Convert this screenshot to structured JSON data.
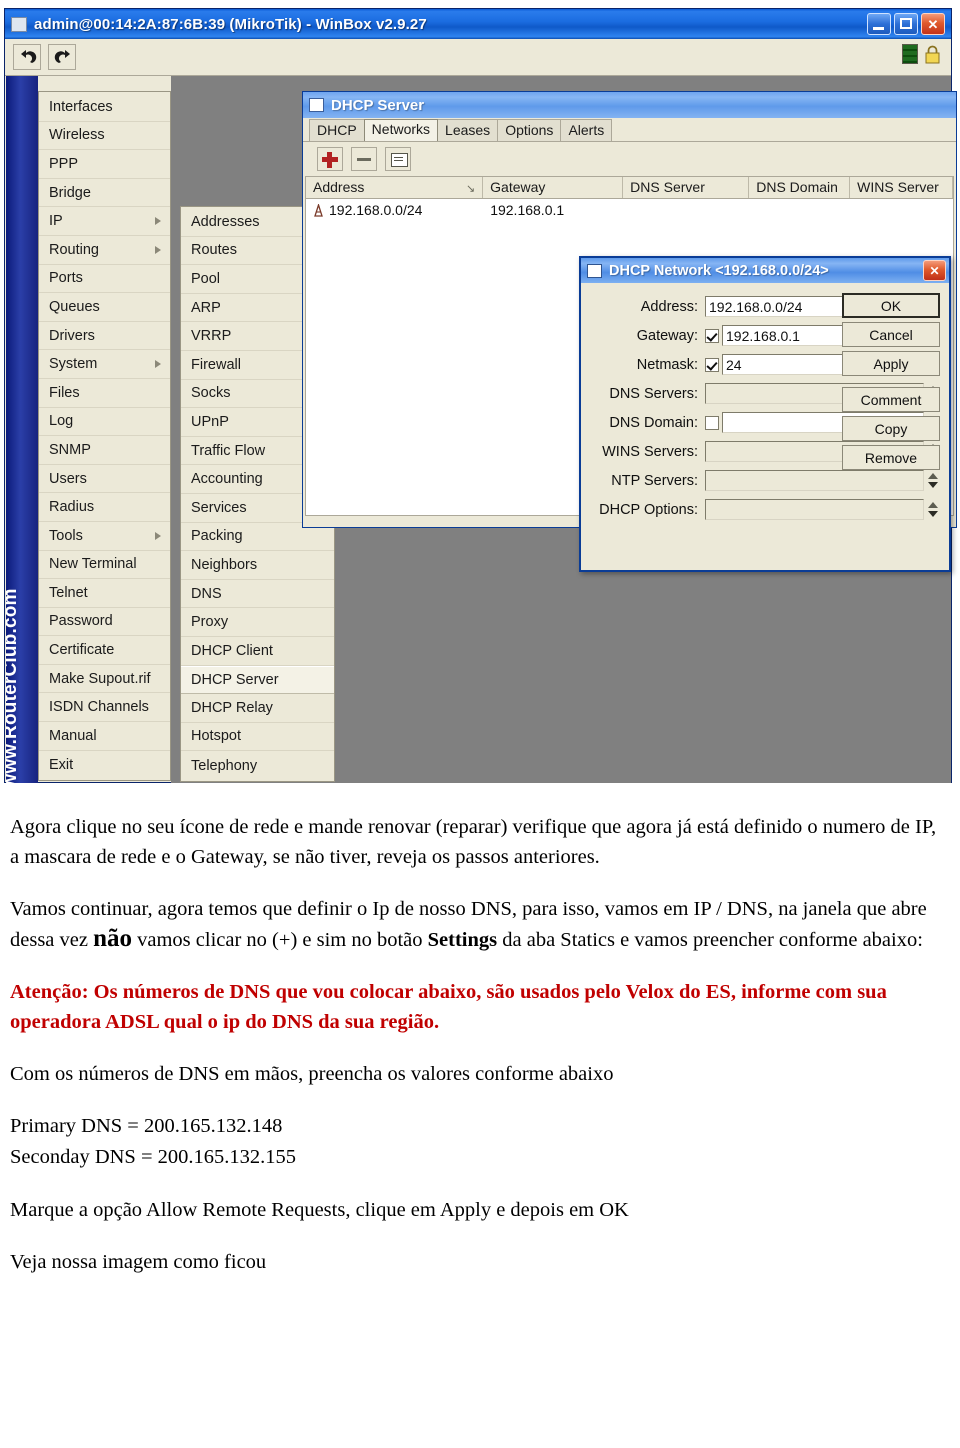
{
  "window": {
    "title": "admin@00:14:2A:87:6B:39 (MikroTik) - WinBox v2.9.27",
    "title_icon": "app-icon",
    "controls": {
      "minimize": "minimize-button",
      "maximize": "maximize-button",
      "close": "✕"
    }
  },
  "toolbar": {
    "undo": "undo-icon",
    "redo": "redo-icon",
    "signal_indicator": "signal-bars-icon",
    "lock_indicator": "padlock-icon"
  },
  "watermark": {
    "text": "RouterOS WinBox www.RouterClub.com"
  },
  "sidebar": {
    "items": [
      {
        "label": "Interfaces",
        "submenu": false
      },
      {
        "label": "Wireless",
        "submenu": false
      },
      {
        "label": "PPP",
        "submenu": false
      },
      {
        "label": "Bridge",
        "submenu": false
      },
      {
        "label": "IP",
        "submenu": true
      },
      {
        "label": "Routing",
        "submenu": true
      },
      {
        "label": "Ports",
        "submenu": false
      },
      {
        "label": "Queues",
        "submenu": false
      },
      {
        "label": "Drivers",
        "submenu": false
      },
      {
        "label": "System",
        "submenu": true
      },
      {
        "label": "Files",
        "submenu": false
      },
      {
        "label": "Log",
        "submenu": false
      },
      {
        "label": "SNMP",
        "submenu": false
      },
      {
        "label": "Users",
        "submenu": false
      },
      {
        "label": "Radius",
        "submenu": false
      },
      {
        "label": "Tools",
        "submenu": true
      },
      {
        "label": "New Terminal",
        "submenu": false
      },
      {
        "label": "Telnet",
        "submenu": false
      },
      {
        "label": "Password",
        "submenu": false
      },
      {
        "label": "Certificate",
        "submenu": false
      },
      {
        "label": "Make Supout.rif",
        "submenu": false
      },
      {
        "label": "ISDN Channels",
        "submenu": false
      },
      {
        "label": "Manual",
        "submenu": false
      },
      {
        "label": "Exit",
        "submenu": false
      }
    ]
  },
  "ip_submenu": {
    "selected": "DHCP Server",
    "items": [
      {
        "label": "Addresses"
      },
      {
        "label": "Routes"
      },
      {
        "label": "Pool"
      },
      {
        "label": "ARP"
      },
      {
        "label": "VRRP"
      },
      {
        "label": "Firewall"
      },
      {
        "label": "Socks"
      },
      {
        "label": "UPnP"
      },
      {
        "label": "Traffic Flow"
      },
      {
        "label": "Accounting"
      },
      {
        "label": "Services"
      },
      {
        "label": "Packing"
      },
      {
        "label": "Neighbors"
      },
      {
        "label": "DNS"
      },
      {
        "label": "Proxy"
      },
      {
        "label": "DHCP Client"
      },
      {
        "label": "DHCP Server"
      },
      {
        "label": "DHCP Relay"
      },
      {
        "label": "Hotspot"
      },
      {
        "label": "Telephony"
      }
    ]
  },
  "dhcp_server_window": {
    "title": "DHCP Server",
    "tabs": [
      {
        "label": "DHCP",
        "active": false
      },
      {
        "label": "Networks",
        "active": true
      },
      {
        "label": "Leases",
        "active": false
      },
      {
        "label": "Options",
        "active": false
      },
      {
        "label": "Alerts",
        "active": false
      }
    ],
    "tools": {
      "add": "plus-icon",
      "remove": "minus-icon",
      "comment": "note-icon"
    },
    "grid": {
      "columns": [
        "Address",
        "Gateway",
        "DNS Server",
        "DNS Domain",
        "WINS Server"
      ],
      "sort_marker": "↘",
      "rows": [
        {
          "address": "192.168.0.0/24",
          "gateway": "192.168.0.1",
          "dns_server": "",
          "dns_domain": "",
          "wins_server": ""
        }
      ]
    }
  },
  "network_dialog": {
    "title": "DHCP Network <192.168.0.0/24>",
    "close": "✕",
    "fields": [
      {
        "label": "Address:",
        "value": "192.168.0.0/24",
        "checkbox": null,
        "spinner": false,
        "dim": false
      },
      {
        "label": "Gateway:",
        "value": "192.168.0.1",
        "checkbox": true,
        "spinner": false,
        "dim": false
      },
      {
        "label": "Netmask:",
        "value": "24",
        "checkbox": true,
        "spinner": false,
        "dim": false
      },
      {
        "label": "DNS Servers:",
        "value": "",
        "checkbox": null,
        "spinner": true,
        "dim": true
      },
      {
        "label": "DNS Domain:",
        "value": "",
        "checkbox": false,
        "spinner": false,
        "dim": false
      },
      {
        "label": "WINS Servers:",
        "value": "",
        "checkbox": null,
        "spinner": true,
        "dim": true
      },
      {
        "label": "NTP Servers:",
        "value": "",
        "checkbox": null,
        "spinner": true,
        "dim": true
      },
      {
        "label": "DHCP Options:",
        "value": "",
        "checkbox": null,
        "spinner": true,
        "dim": true
      }
    ],
    "buttons": [
      {
        "label": "OK",
        "default": true,
        "gap": false
      },
      {
        "label": "Cancel",
        "default": false,
        "gap": false
      },
      {
        "label": "Apply",
        "default": false,
        "gap": false
      },
      {
        "label": "Comment",
        "default": false,
        "gap": true
      },
      {
        "label": "Copy",
        "default": false,
        "gap": false
      },
      {
        "label": "Remove",
        "default": false,
        "gap": false
      }
    ]
  },
  "document": {
    "p1": "Agora clique no seu ícone de rede e mande renovar (reparar) verifique que agora já está definido o numero de IP, a mascara de rede e o Gateway, se não tiver, reveja os passos anteriores.",
    "p2_a": "Vamos continuar, agora temos que definir o Ip de nosso DNS, para isso, vamos em IP / DNS, na janela que abre dessa vez ",
    "p2_big": "não",
    "p2_b": " vamos clicar no (+) e sim no botão ",
    "p2_bold": "Settings",
    "p2_c": " da aba Statics e vamos preencher conforme abaixo:",
    "p3_red": "Atenção: Os números de DNS que vou colocar abaixo, são usados pelo Velox do ES, informe com sua operadora ADSL qual o ip do DNS da sua região.",
    "p4": "Com os números de DNS em mãos, preencha os valores conforme abaixo",
    "dns_primary": "Primary DNS = 200.165.132.148",
    "dns_secondary": "Seconday DNS = 200.165.132.155",
    "p5": "Marque a opção Allow Remote Requests, clique em Apply e depois em OK",
    "p6": "Veja nossa imagem como ficou"
  }
}
